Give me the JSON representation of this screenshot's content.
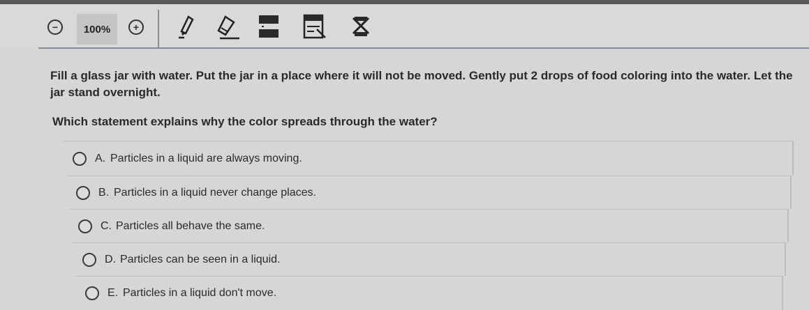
{
  "toolbar": {
    "zoom_out_label": "−",
    "zoom_level": "100%",
    "zoom_in_label": "+",
    "tools": [
      "highlighter-icon",
      "eraser-icon",
      "line-reader-icon",
      "answer-masking-icon",
      "answer-eliminator-icon"
    ]
  },
  "passage": "Fill a glass jar with water. Put the jar in a place where it will not be moved. Gently put 2 drops of food coloring into the water. Let the jar stand overnight.",
  "question": "Which statement explains why the color spreads through the water?",
  "options": [
    {
      "letter": "A.",
      "text": "Particles in a liquid are always moving."
    },
    {
      "letter": "B.",
      "text": "Particles in a liquid never change places."
    },
    {
      "letter": "C.",
      "text": "Particles all behave the same."
    },
    {
      "letter": "D.",
      "text": "Particles can be seen in a liquid."
    },
    {
      "letter": "E.",
      "text": "Particles in a liquid don't move."
    }
  ]
}
